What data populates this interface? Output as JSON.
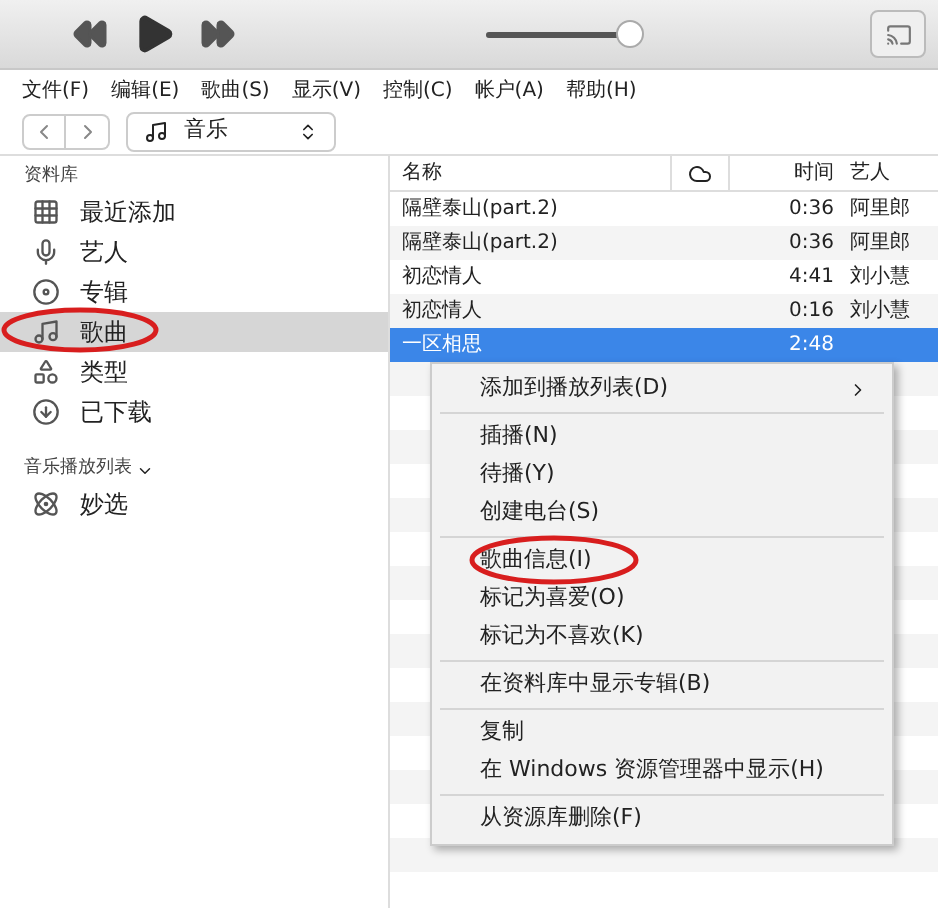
{
  "player": {
    "volume": {
      "level": 0.92
    }
  },
  "menubar": [
    "文件(F)",
    "编辑(E)",
    "歌曲(S)",
    "显示(V)",
    "控制(C)",
    "帐户(A)",
    "帮助(H)"
  ],
  "nav": {
    "source": "音乐"
  },
  "sidebar": {
    "library_title": "资料库",
    "items": [
      {
        "label": "最近添加",
        "selected": false,
        "circled": false
      },
      {
        "label": "艺人",
        "selected": false,
        "circled": false
      },
      {
        "label": "专辑",
        "selected": false,
        "circled": false
      },
      {
        "label": "歌曲",
        "selected": true,
        "circled": true
      },
      {
        "label": "类型",
        "selected": false,
        "circled": false
      },
      {
        "label": "已下载",
        "selected": false,
        "circled": false
      }
    ],
    "playlists_title": "音乐播放列表",
    "playlists": [
      {
        "label": "妙选"
      }
    ]
  },
  "table": {
    "columns": [
      "名称",
      "时间",
      "艺人"
    ],
    "rows": [
      {
        "name": "隔壁泰山(part.2)",
        "time": "0:36",
        "artist": "阿里郎",
        "selected": false
      },
      {
        "name": "隔壁泰山(part.2)",
        "time": "0:36",
        "artist": "阿里郎",
        "selected": false
      },
      {
        "name": "初恋情人",
        "time": "4:41",
        "artist": "刘小慧",
        "selected": false
      },
      {
        "name": "初恋情人",
        "time": "0:16",
        "artist": "刘小慧",
        "selected": false
      },
      {
        "name": "一区相思",
        "time": "2:48",
        "artist": "",
        "selected": true
      }
    ]
  },
  "context_menu": [
    [
      {
        "label": "添加到播放列表(D)",
        "submenu": true,
        "circled": false
      }
    ],
    [
      {
        "label": "插播(N)",
        "submenu": false,
        "circled": false
      },
      {
        "label": "待播(Y)",
        "submenu": false,
        "circled": false
      },
      {
        "label": "创建电台(S)",
        "submenu": false,
        "circled": false
      }
    ],
    [
      {
        "label": "歌曲信息(I)",
        "submenu": false,
        "circled": true
      },
      {
        "label": "标记为喜爱(O)",
        "submenu": false,
        "circled": false
      },
      {
        "label": "标记为不喜欢(K)",
        "submenu": false,
        "circled": false
      }
    ],
    [
      {
        "label": "在资料库中显示专辑(B)",
        "submenu": false,
        "circled": false
      }
    ],
    [
      {
        "label": "复制",
        "submenu": false,
        "circled": false
      },
      {
        "label": "在 Windows 资源管理器中显示(H)",
        "submenu": false,
        "circled": false
      }
    ],
    [
      {
        "label": "从资源库删除(F)",
        "submenu": false,
        "circled": false
      }
    ]
  ]
}
